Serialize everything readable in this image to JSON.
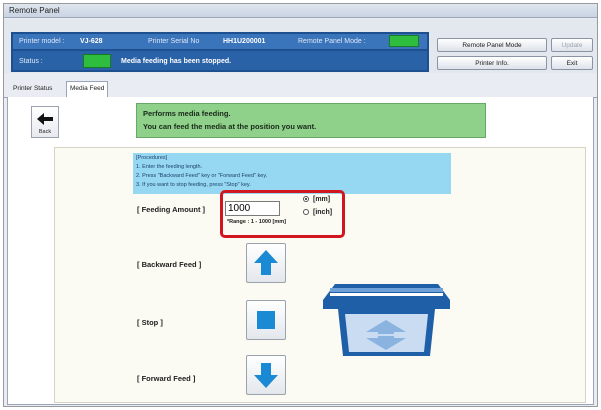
{
  "window": {
    "title": "Remote Panel"
  },
  "header": {
    "printer_model_label": "Printer model :",
    "printer_model_value": "VJ-628",
    "serial_label": "Printer Serial No",
    "serial_value": "HH1U200001",
    "mode_label": "Remote Panel Mode :",
    "status_label": "Status :",
    "status_message": "Media feeding has been stopped.",
    "indicator_color": "#2ebd3e",
    "buttons": {
      "remote_panel_mode": "Remote Panel Mode",
      "update": "Update",
      "printer_info": "Printer Info.",
      "exit": "Exit"
    }
  },
  "tabs": [
    {
      "label": "Printer Status",
      "active": false
    },
    {
      "label": "Media Feed",
      "active": true
    }
  ],
  "back": {
    "label": "Back",
    "icon": "arrow-left-icon"
  },
  "banner": {
    "line1": "Performs media feeding.",
    "line2": "You can feed the media at the position you want.",
    "color": "#8fd08a"
  },
  "procedures": {
    "title": "[Procedures]",
    "steps": [
      "1. Enter the feeding length.",
      "2. Press \"Backward Feed\" key or \"Forward Feed\" key.",
      "3. If you want to stop feeding, press \"Stop\" key."
    ]
  },
  "feeding": {
    "amount_label": "[ Feeding Amount ]",
    "amount_value": "1000",
    "unit_mm": "[mm]",
    "unit_inch": "[inch]",
    "selected_unit": "mm",
    "range": "*Range : 1 - 1000 [mm]"
  },
  "controls": {
    "backward_label": "[ Backward Feed ]",
    "stop_label": "[ Stop ]",
    "forward_label": "[ Forward Feed ]",
    "backward_icon": "arrow-up-icon",
    "stop_icon": "stop-square-icon",
    "forward_icon": "arrow-down-icon",
    "icon_color": "#1a8ad4"
  },
  "highlight_color": "#d2161f"
}
